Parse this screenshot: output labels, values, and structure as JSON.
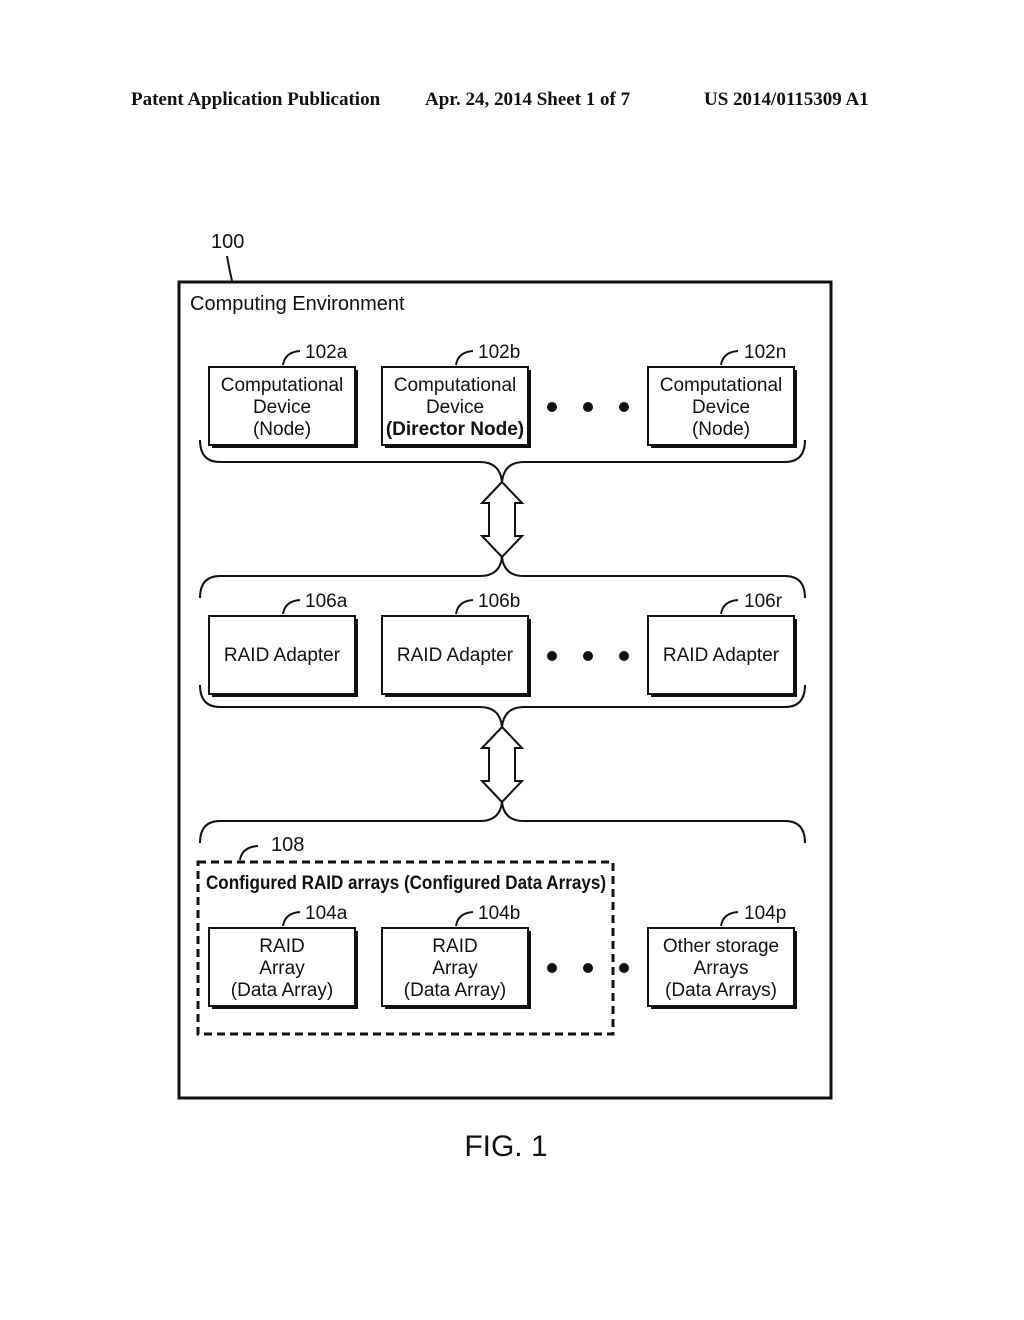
{
  "header": {
    "left": "Patent Application Publication",
    "center": "Apr. 24, 2014  Sheet 1 of 7",
    "right": "US 2014/0115309 A1"
  },
  "figure": {
    "ref": "100",
    "title": "Computing Environment",
    "caption": "FIG. 1",
    "devices": [
      {
        "ref": "102a",
        "lines": [
          "Computational",
          "Device",
          "(Node)"
        ],
        "bold_last": false
      },
      {
        "ref": "102b",
        "lines": [
          "Computational",
          "Device",
          "(Director Node)"
        ],
        "bold_last": true
      },
      {
        "ref": "102n",
        "lines": [
          "Computational",
          "Device",
          "(Node)"
        ],
        "bold_last": false
      }
    ],
    "adapters": [
      {
        "ref": "106a",
        "label": "RAID Adapter"
      },
      {
        "ref": "106b",
        "label": "RAID Adapter"
      },
      {
        "ref": "106r",
        "label": "RAID Adapter"
      }
    ],
    "configured_group": {
      "ref": "108",
      "label": "Configured RAID arrays (Configured Data Arrays)"
    },
    "arrays": [
      {
        "ref": "104a",
        "lines": [
          "RAID",
          "Array",
          "(Data Array)"
        ]
      },
      {
        "ref": "104b",
        "lines": [
          "RAID",
          "Array",
          "(Data Array)"
        ]
      },
      {
        "ref": "104p",
        "lines": [
          "Other storage",
          "Arrays",
          "(Data Arrays)"
        ]
      }
    ],
    "ellipsis": "• • •"
  }
}
